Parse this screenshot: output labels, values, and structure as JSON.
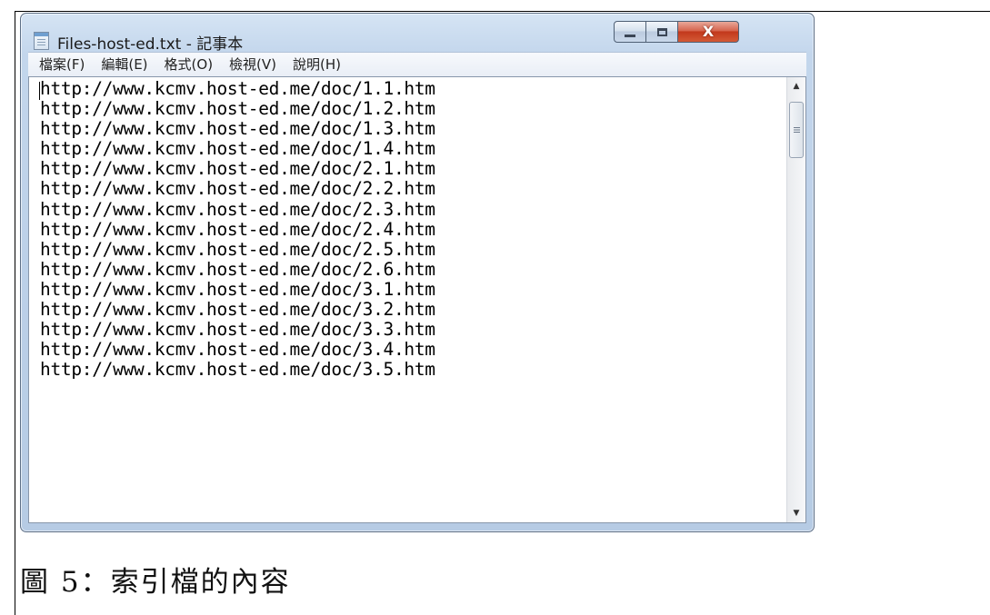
{
  "window": {
    "title": "Files-host-ed.txt - 記事本",
    "controls": {
      "minimize_icon": "minimize-icon",
      "maximize_icon": "maximize-icon",
      "close_icon": "close-icon",
      "close_glyph": "X"
    }
  },
  "menu": {
    "items": [
      {
        "label": "檔案(F)"
      },
      {
        "label": "編輯(E)"
      },
      {
        "label": "格式(O)"
      },
      {
        "label": "檢視(V)"
      },
      {
        "label": "說明(H)"
      }
    ]
  },
  "editor": {
    "lines": [
      "http://www.kcmv.host-ed.me/doc/1.1.htm",
      "http://www.kcmv.host-ed.me/doc/1.2.htm",
      "http://www.kcmv.host-ed.me/doc/1.3.htm",
      "http://www.kcmv.host-ed.me/doc/1.4.htm",
      "http://www.kcmv.host-ed.me/doc/2.1.htm",
      "http://www.kcmv.host-ed.me/doc/2.2.htm",
      "http://www.kcmv.host-ed.me/doc/2.3.htm",
      "http://www.kcmv.host-ed.me/doc/2.4.htm",
      "http://www.kcmv.host-ed.me/doc/2.5.htm",
      "http://www.kcmv.host-ed.me/doc/2.6.htm",
      "http://www.kcmv.host-ed.me/doc/3.1.htm",
      "http://www.kcmv.host-ed.me/doc/3.2.htm",
      "http://www.kcmv.host-ed.me/doc/3.3.htm",
      "http://www.kcmv.host-ed.me/doc/3.4.htm",
      "http://www.kcmv.host-ed.me/doc/3.5.htm"
    ]
  },
  "caption": "圖 5：索引檔的內容"
}
